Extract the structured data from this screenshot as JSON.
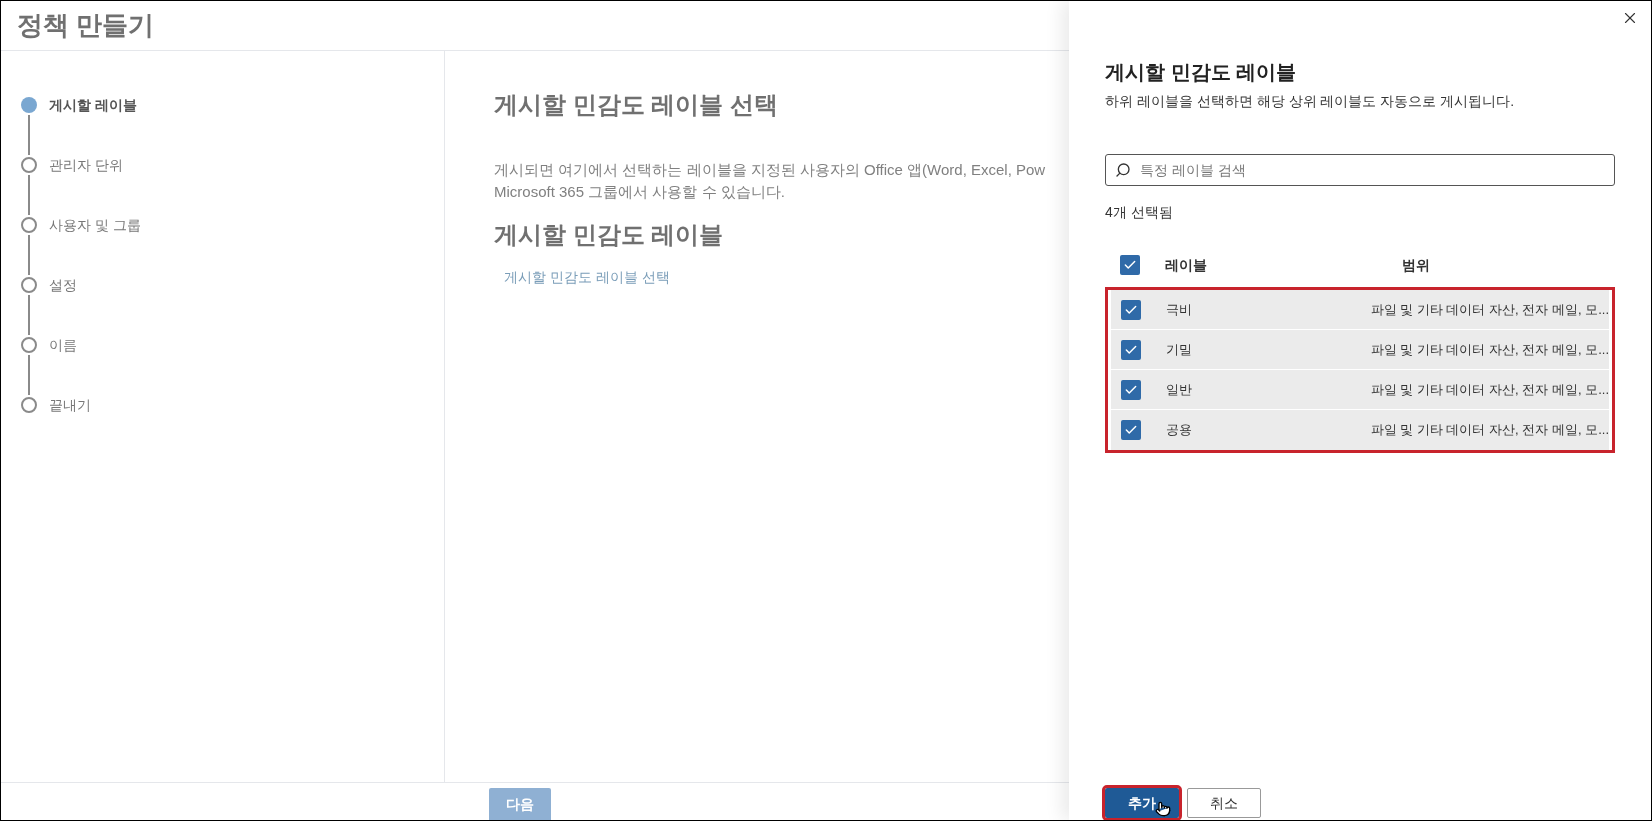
{
  "page": {
    "title": "정책 만들기"
  },
  "steps": [
    {
      "label": "게시할 레이블",
      "selected": true
    },
    {
      "label": "관리자 단위",
      "selected": false
    },
    {
      "label": "사용자 및 그룹",
      "selected": false
    },
    {
      "label": "설정",
      "selected": false
    },
    {
      "label": "이름",
      "selected": false
    },
    {
      "label": "끝내기",
      "selected": false
    }
  ],
  "main": {
    "heading": "게시할 민감도 레이블 선택",
    "description": "게시되면 여기에서 선택하는 레이블을 지정된 사용자의 Office 앱(Word, Excel, Pow",
    "description_2": "Microsoft 365 그룹에서 사용할 수 있습니다.",
    "subheading": "게시할 민감도 레이블",
    "link": "게시할 민감도 레이블 선택",
    "next_button": "다음"
  },
  "panel": {
    "title": "게시할 민감도 레이블",
    "subtitle": "하위 레이블을 선택하면 해당 상위 레이블도 자동으로 게시됩니다.",
    "search": {
      "placeholder": "특정 레이블 검색"
    },
    "selected_count": "4개 선택됨",
    "table": {
      "all_checked": true,
      "columns": [
        "레이블",
        "범위"
      ],
      "rows": [
        {
          "label": "극비",
          "scope": "파일 및 기타 데이터 자산, 전자 메일, 모...",
          "checked": true
        },
        {
          "label": "기밀",
          "scope": "파일 및 기타 데이터 자산, 전자 메일, 모...",
          "checked": true
        },
        {
          "label": "일반",
          "scope": "파일 및 기타 데이터 자산, 전자 메일, 모...",
          "checked": true
        },
        {
          "label": "공용",
          "scope": "파일 및 기타 데이터 자산, 전자 메일, 모...",
          "checked": true
        }
      ]
    },
    "buttons": [
      {
        "label": "추가",
        "kind": "primary"
      },
      {
        "label": "취소",
        "kind": "secondary"
      }
    ]
  }
}
